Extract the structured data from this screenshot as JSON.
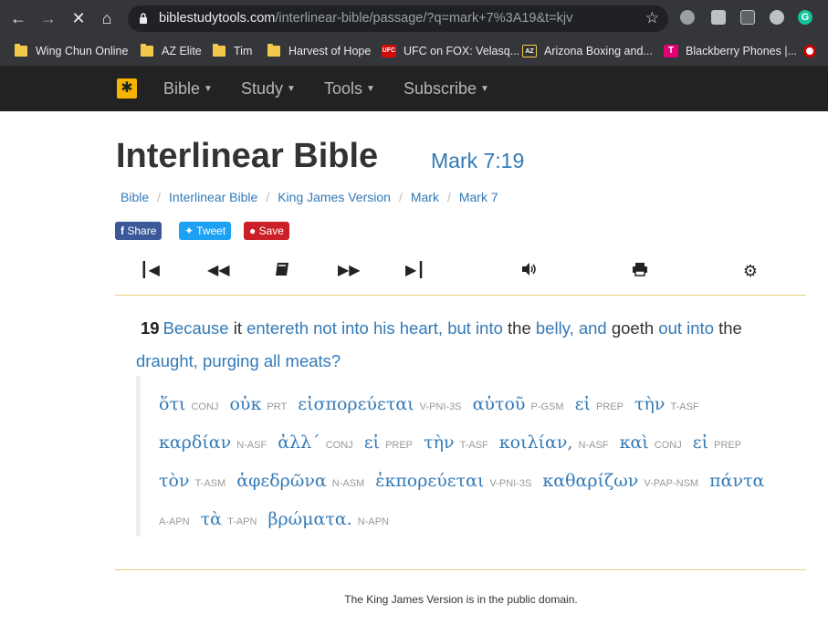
{
  "browser": {
    "url_domain": "biblestudytools.com",
    "url_rest": "/interlinear-bible/passage/?q=mark+7%3A19&t=kjv",
    "bookmarks": [
      {
        "label": "Wing Chun Online",
        "type": "folder"
      },
      {
        "label": "AZ Elite",
        "type": "folder"
      },
      {
        "label": "Tim",
        "type": "folder"
      },
      {
        "label": "Harvest of Hope",
        "type": "folder"
      },
      {
        "label": "UFC on FOX: Velasq...",
        "type": "site",
        "badge": "UFC",
        "color": "#d20a0a"
      },
      {
        "label": "Arizona Boxing and...",
        "type": "site",
        "badge": "AZ",
        "color": "#333333"
      },
      {
        "label": "Blackberry Phones |...",
        "type": "site",
        "badge": "T",
        "color": "#e20074"
      }
    ]
  },
  "nav": {
    "items": [
      "Bible",
      "Study",
      "Tools",
      "Subscribe"
    ]
  },
  "page": {
    "title": "Interlinear Bible",
    "reference": "Mark 7:19",
    "breadcrumbs": [
      "Bible",
      "Interlinear Bible",
      "King James Version",
      "Mark",
      "Mark 7"
    ],
    "share": {
      "facebook": "Share",
      "twitter": "Tweet",
      "pinterest": "Save"
    }
  },
  "verse": {
    "number": "19",
    "segments": [
      {
        "t": "Because",
        "hl": true
      },
      {
        "t": " it ",
        "hl": false
      },
      {
        "t": "entereth not into his heart, but into",
        "hl": true
      },
      {
        "t": " the ",
        "hl": false
      },
      {
        "t": "belly, and",
        "hl": true
      },
      {
        "t": " goeth ",
        "hl": false
      },
      {
        "t": "out into",
        "hl": true
      },
      {
        "t": " the ",
        "hl": false
      },
      {
        "t": "draught, purging all meats?",
        "hl": true
      }
    ]
  },
  "greek": [
    {
      "w": "ὅτι",
      "p": "CONJ"
    },
    {
      "w": "οὐκ",
      "p": "PRT"
    },
    {
      "w": "εἰσπορεύεται",
      "p": "V-PNI-3S"
    },
    {
      "w": "αὐτοῦ",
      "p": "P-GSM"
    },
    {
      "w": "εἰ",
      "p": "PREP"
    },
    {
      "w": "τὴν",
      "p": "T-ASF"
    },
    {
      "w": "καρδίαν",
      "p": "N-ASF"
    },
    {
      "w": "ἀλλ´",
      "p": "CONJ"
    },
    {
      "w": "εἰ",
      "p": "PREP"
    },
    {
      "w": "τὴν",
      "p": "T-ASF"
    },
    {
      "w": "κοιλίαν,",
      "p": "N-ASF"
    },
    {
      "w": "καὶ",
      "p": "CONJ"
    },
    {
      "w": "εἰ",
      "p": "PREP"
    },
    {
      "w": "τὸν",
      "p": "T-ASM"
    },
    {
      "w": "ἀφεδρῶνα",
      "p": "N-ASM"
    },
    {
      "w": "ἐκπορεύεται",
      "p": "V-PNI-3S"
    },
    {
      "w": "καθαρίζων",
      "p": "V-PAP-NSM"
    },
    {
      "w": "πάντα",
      "p": "A-APN"
    },
    {
      "w": "τὰ",
      "p": "T-APN"
    },
    {
      "w": "βρώματα.",
      "p": "N-APN"
    }
  ],
  "footer": "The King James Version is in the public domain.",
  "colors": {
    "link": "#337ab7",
    "facebook": "#3b5998",
    "twitter": "#1da1f2",
    "pinterest": "#cb2027",
    "rule": "#e6cf7a"
  }
}
